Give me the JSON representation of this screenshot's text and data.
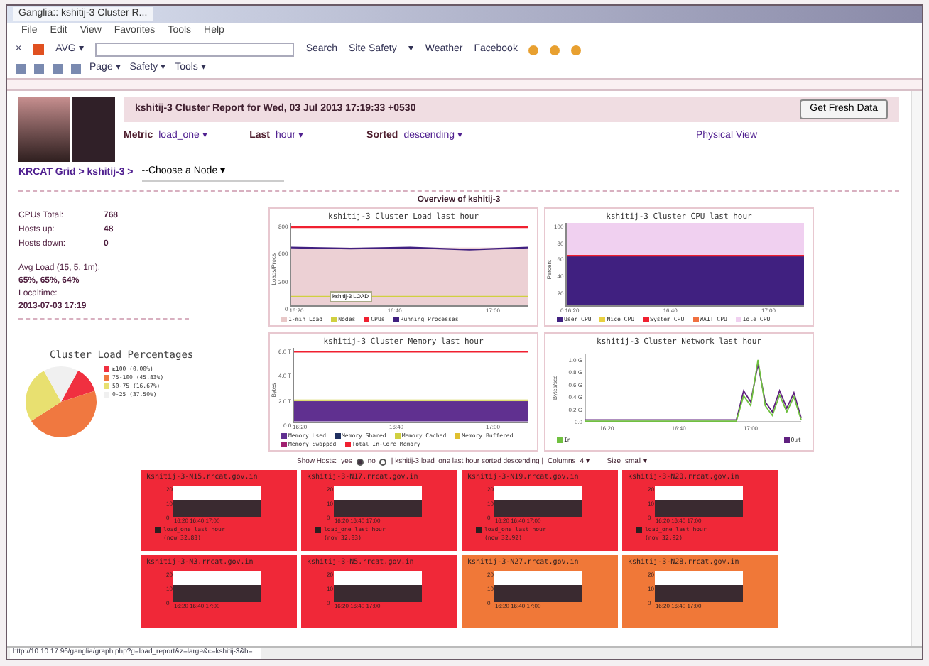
{
  "browser": {
    "title": "Ganglia:: kshitij-3 Cluster R...",
    "menu": [
      "File",
      "Edit",
      "View",
      "Favorites",
      "Tools",
      "Help"
    ],
    "close": "×",
    "toolbar": [
      {
        "label": "AVG ▾"
      },
      {
        "label": "Search"
      },
      {
        "label": "Site Safety"
      },
      {
        "label": "▾"
      },
      {
        "label": "Weather"
      },
      {
        "label": "Facebook"
      }
    ],
    "command_bar": [
      "Page ▾",
      "Safety ▾",
      "Tools ▾"
    ],
    "status_url": "http://10.10.17.96/ganglia/graph.php?g=load_report&z=large&c=kshitij-3&h=..."
  },
  "header": {
    "title": "kshitij-3 Cluster Report for Wed, 03 Jul 2013 17:19:33 +0530",
    "button": "Get Fresh Data"
  },
  "controls": [
    {
      "label": "Metric",
      "value": "load_one",
      "caret": "▾"
    },
    {
      "label": "Last",
      "value": "hour",
      "caret": "▾"
    },
    {
      "label": "Sorted",
      "value": "descending",
      "caret": "▾"
    }
  ],
  "physical_view": "Physical View",
  "breadcrumb": {
    "path": "KRCAT Grid > kshitij-3 >",
    "node_select": "--Choose a Node",
    "caret": "▾"
  },
  "overview_title": "Overview of kshitij-3",
  "stats": [
    {
      "label": "CPUs Total:",
      "value": "768"
    },
    {
      "label": "Hosts up:",
      "value": "48"
    },
    {
      "label": "Hosts down:",
      "value": "0"
    }
  ],
  "load": {
    "label": "Avg Load (15, 5, 1m):",
    "value": "65%, 65%, 64%"
  },
  "localtime": {
    "label": "Localtime:",
    "value": "2013-07-03 17:19"
  },
  "pie": {
    "title": "Cluster Load Percentages",
    "legend": [
      {
        "label": "≥100 (0.00%)",
        "color": "#f03040"
      },
      {
        "label": "75-100 (45.83%)",
        "color": "#f07840"
      },
      {
        "label": "50-75 (16.67%)",
        "color": "#e8e070"
      },
      {
        "label": "0-25 (37.50%)",
        "color": "#f0f0f0"
      }
    ]
  },
  "graphs": [
    {
      "kind": "load",
      "title": "kshitij-3 Cluster Load last hour",
      "ylabel": "Loads/Procs",
      "yticks": [
        "800",
        "600",
        "200",
        "0"
      ],
      "xticks": [
        "16:20",
        "16:40",
        "17:00"
      ],
      "tooltip": "kshitij-3 LOAD",
      "legend": [
        {
          "label": "1-min Load",
          "color": "#e8c8c8"
        },
        {
          "label": "Nodes",
          "color": "#d0d040"
        },
        {
          "label": "CPUs",
          "color": "#f02030"
        },
        {
          "label": "Running Processes",
          "color": "#402080"
        }
      ]
    },
    {
      "kind": "cpu",
      "title": "kshitij-3 Cluster CPU last hour",
      "ylabel": "Percent",
      "yticks": [
        "100",
        "80",
        "60",
        "40",
        "20",
        "0"
      ],
      "xticks": [
        "16:20",
        "16:40",
        "17:00"
      ],
      "legend": [
        {
          "label": "User CPU",
          "color": "#402080"
        },
        {
          "label": "Nice CPU",
          "color": "#e8d040"
        },
        {
          "label": "System CPU",
          "color": "#f02030"
        },
        {
          "label": "WAIT CPU",
          "color": "#f07040"
        },
        {
          "label": "Idle CPU",
          "color": "#f0d0f0"
        }
      ]
    },
    {
      "kind": "memory",
      "title": "kshitij-3 Cluster Memory last hour",
      "ylabel": "Bytes",
      "yticks": [
        "6.0 T",
        "4.0 T",
        "2.0 T",
        "0.0"
      ],
      "xticks": [
        "16:20",
        "16:40",
        "17:00"
      ],
      "legend": [
        {
          "label": "Memory Used",
          "color": "#603090"
        },
        {
          "label": "Memory Shared",
          "color": "#203060"
        },
        {
          "label": "Memory Cached",
          "color": "#d0d040"
        },
        {
          "label": "Memory Buffered",
          "color": "#e0c030"
        },
        {
          "label": "Memory Swapped",
          "color": "#a02070"
        },
        {
          "label": "Total In-Core Memory",
          "color": "#f02030"
        }
      ]
    },
    {
      "kind": "network",
      "title": "kshitij-3 Cluster Network last hour",
      "time_labels": [
        "16:20",
        "16:40",
        "17:00"
      ],
      "chart_data": {
        "type": "line",
        "ylabel": "Bytes/sec",
        "ylim": [
          0,
          1.1
        ],
        "yticks": [
          {
            "value": 1,
            "label": "1.0 G"
          },
          {
            "value": 0.8,
            "label": "0.8 G"
          },
          {
            "value": 0.6,
            "label": "0.6 G"
          },
          {
            "value": 0.4,
            "label": "0.4 G"
          },
          {
            "value": 0.2,
            "label": "0.2 G"
          },
          {
            "value": 0,
            "label": "0.0"
          }
        ],
        "series": [
          {
            "name": "In",
            "color": "#70c040",
            "values": [
              0.01,
              0.01,
              0.01,
              0.01,
              0.01,
              0.01,
              0.01,
              0.01,
              0.01,
              0.01,
              0.01,
              0.01,
              0.01,
              0.01,
              0.01,
              0.01,
              0.01,
              0.01,
              0.01,
              0.01,
              0.01,
              0.01,
              0.42,
              0.26,
              1.0,
              0.26,
              0.1,
              0.43,
              0.16,
              0.4,
              0.03
            ]
          },
          {
            "name": "Out",
            "color": "#602080",
            "values": [
              0.03,
              0.03,
              0.03,
              0.03,
              0.03,
              0.03,
              0.03,
              0.03,
              0.03,
              0.03,
              0.03,
              0.03,
              0.03,
              0.03,
              0.03,
              0.03,
              0.03,
              0.03,
              0.03,
              0.03,
              0.03,
              0.03,
              0.5,
              0.32,
              0.93,
              0.32,
              0.16,
              0.5,
              0.22,
              0.47,
              0.06
            ]
          }
        ]
      }
    }
  ],
  "sortbar": {
    "show_hosts": "Show Hosts:",
    "yes": {
      "label": "yes",
      "selected": true
    },
    "no": {
      "label": "no",
      "selected": false
    },
    "summary": "| kshitij-3 load_one last hour sorted descending |",
    "columns_label": "Columns",
    "columns": "4",
    "size_label": "Size",
    "size": "small",
    "caret": "▾"
  },
  "hosts": [
    {
      "name": "kshitij-3-N15.rrcat.gov.in",
      "color": "#f02838",
      "yticks": [
        "20",
        "10",
        "0"
      ],
      "xticks": "16:20 16:40 17:00",
      "legend": "load_one last hour",
      "now": "(now 32.83)"
    },
    {
      "name": "kshitij-3-N17.rrcat.gov.in",
      "color": "#f02838",
      "yticks": [
        "20",
        "10",
        "0"
      ],
      "xticks": "16:20 16:40 17:00",
      "legend": "load_one last hour",
      "now": "(now 32.83)"
    },
    {
      "name": "kshitij-3-N19.rrcat.gov.in",
      "color": "#f02838",
      "yticks": [
        "20",
        "10",
        "0"
      ],
      "xticks": "16:20 16:40 17:00",
      "legend": "load_one last hour",
      "now": "(now 32.92)"
    },
    {
      "name": "kshitij-3-N20.rrcat.gov.in",
      "color": "#f02838",
      "yticks": [
        "20",
        "10",
        "0"
      ],
      "xticks": "16:20 16:40 17:00",
      "legend": "load_one last hour",
      "now": "(now 32.92)"
    },
    {
      "name": "kshitij-3-N3.rrcat.gov.in",
      "color": "#f02838",
      "yticks": [
        "20",
        "10",
        "0"
      ],
      "xticks": "16:20 16:40 17:00"
    },
    {
      "name": "kshitij-3-N5.rrcat.gov.in",
      "color": "#f02838",
      "yticks": [
        "20",
        "10",
        "0"
      ],
      "xticks": "16:20 16:40 17:00"
    },
    {
      "name": "kshitij-3-N27.rrcat.gov.in",
      "color": "#f07838",
      "yticks": [
        "20",
        "10",
        "0"
      ],
      "xticks": "16:20 16:40 17:00"
    },
    {
      "name": "kshitij-3-N28.rrcat.gov.in",
      "color": "#f07838",
      "yticks": [
        "20",
        "10",
        "0"
      ],
      "xticks": "16:20 16:40 17:00"
    }
  ]
}
